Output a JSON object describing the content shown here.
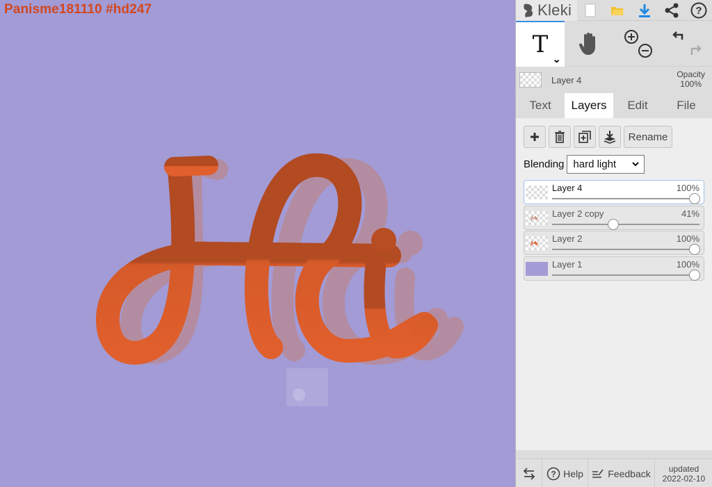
{
  "canvas": {
    "title": "Panisme181110 #hd247",
    "background_color": "#a29bd6",
    "text_color": "#d2481f"
  },
  "app": {
    "name": "Kleki"
  },
  "toolbar": {
    "icons": [
      "new-file-icon",
      "open-folder-icon",
      "download-icon",
      "share-icon",
      "help-icon"
    ],
    "tools": [
      "text-tool",
      "hand-tool",
      "zoom-in-out",
      "undo-redo"
    ],
    "active_tool": "text-tool",
    "text_tool_glyph": "T"
  },
  "current_layer": {
    "name": "Layer 4",
    "opacity_label": "Opacity",
    "opacity_value": "100%"
  },
  "tabs": [
    {
      "label": "Text",
      "active": false
    },
    {
      "label": "Layers",
      "active": true
    },
    {
      "label": "Edit",
      "active": false
    },
    {
      "label": "File",
      "active": false
    }
  ],
  "layers_panel": {
    "rename_label": "Rename",
    "blending_label": "Blending",
    "blending_value": "hard light",
    "layers": [
      {
        "name": "Layer 4",
        "opacity": "100%",
        "selected": true
      },
      {
        "name": "Layer 2 copy",
        "opacity": "41%",
        "selected": false
      },
      {
        "name": "Layer 2",
        "opacity": "100%",
        "selected": false
      },
      {
        "name": "Layer 1",
        "opacity": "100%",
        "selected": false
      }
    ]
  },
  "footer": {
    "help_label": "Help",
    "feedback_label": "Feedback",
    "updated_label": "updated",
    "updated_date": "2022-02-10"
  },
  "colors": {
    "accent": "#3a8de3",
    "artwork_front": "#d85b2b",
    "artwork_shadow": "#b08a99"
  }
}
